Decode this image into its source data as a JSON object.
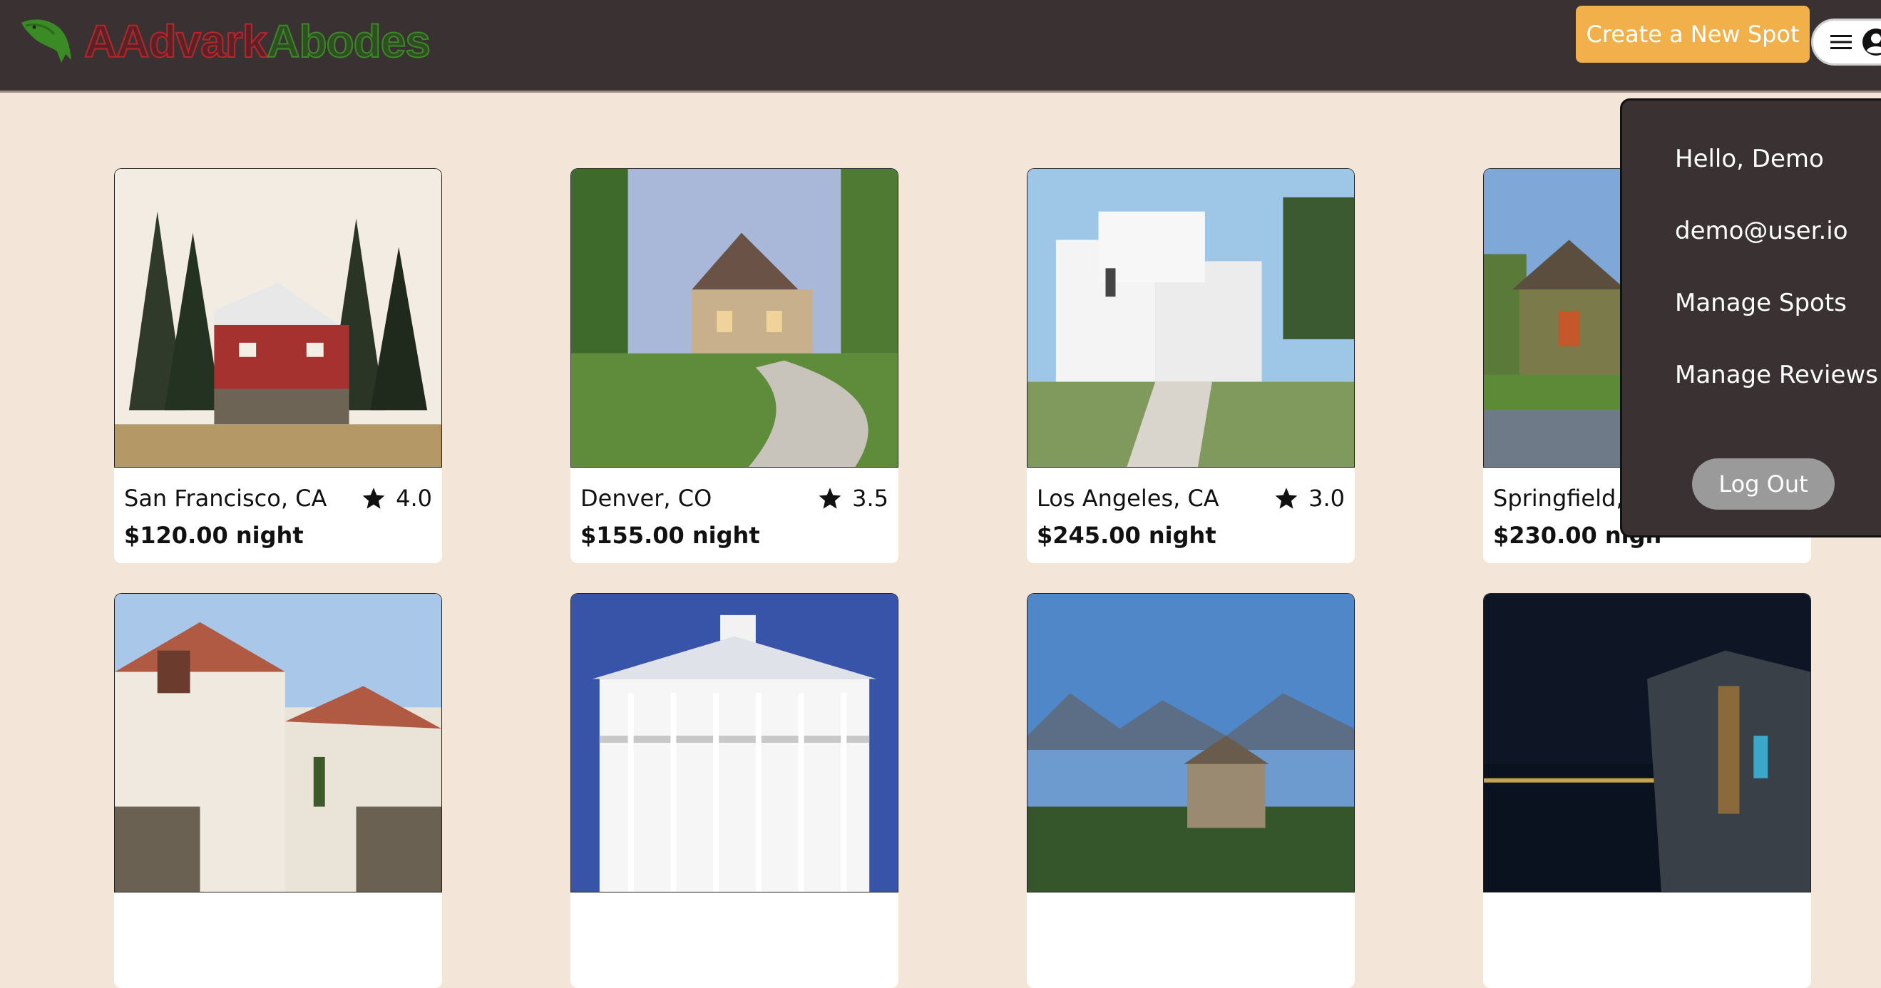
{
  "header": {
    "logo_text_part1": "AAdvark",
    "logo_text_part2": "Abodes",
    "create_spot_label": "Create a New Spot"
  },
  "spots": [
    {
      "city": "San Francisco, CA",
      "rating": "4.0",
      "price": "$120.00",
      "unit": "night"
    },
    {
      "city": "Denver, CO",
      "rating": "3.5",
      "price": "$155.00",
      "unit": "night"
    },
    {
      "city": "Los Angeles, CA",
      "rating": "3.0",
      "price": "$245.00",
      "unit": "night"
    },
    {
      "city": "Springfield, C",
      "rating": "",
      "price": "$230.00",
      "unit": "nigh"
    },
    {
      "city": "",
      "rating": "",
      "price": "",
      "unit": ""
    },
    {
      "city": "",
      "rating": "",
      "price": "",
      "unit": ""
    },
    {
      "city": "",
      "rating": "",
      "price": "",
      "unit": ""
    },
    {
      "city": "",
      "rating": "",
      "price": "",
      "unit": ""
    }
  ],
  "user_menu": {
    "greeting": "Hello, Demo",
    "email": "demo@user.io",
    "manage_spots": "Manage Spots",
    "manage_reviews": "Manage Reviews",
    "logout_label": "Log Out"
  },
  "colors": {
    "header_bg": "#3a3232",
    "page_bg": "#f3e6d8",
    "accent_button": "#f2b04a",
    "logo_red": "#b8262a",
    "logo_green": "#3a8a26",
    "logout_button": "#9a9a9a"
  }
}
